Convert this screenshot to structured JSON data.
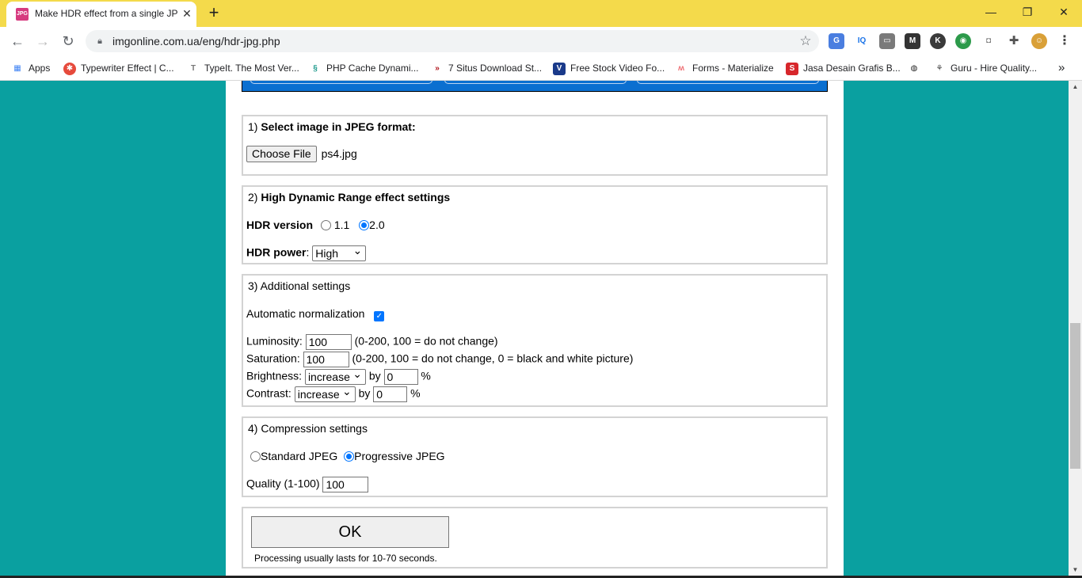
{
  "browser": {
    "tab_title": "Make HDR effect from a single JPG",
    "tab_favicon_text": "JPG",
    "url": "imgonline.com.ua/eng/hdr-jpg.php",
    "bookmarks": [
      {
        "label": "Apps",
        "icon": "apps-grid-icon"
      },
      {
        "label": "Typewriter Effect | C...",
        "icon": "typewriter-icon"
      },
      {
        "label": "TypeIt. The Most Ver...",
        "icon": "typeit-icon"
      },
      {
        "label": "PHP Cache Dynami...",
        "icon": "php-cache-icon"
      },
      {
        "label": "7 Situs Download St...",
        "icon": "chevrons-icon"
      },
      {
        "label": "Free Stock Video Fo...",
        "icon": "v-logo-icon"
      },
      {
        "label": "Forms - Materialize",
        "icon": "materialize-icon"
      },
      {
        "label": "Jasa Desain Grafis B...",
        "icon": "s-logo-icon"
      },
      {
        "label": "",
        "icon": "globe-icon"
      },
      {
        "label": "Guru - Hire Quality...",
        "icon": "guru-icon"
      }
    ],
    "colors": {
      "titlebar": "#f4da4b",
      "page_bg": "#0aa0a0",
      "banner": "#0b6fd0",
      "accent": "#0075ff"
    }
  },
  "form": {
    "section1": {
      "number": "1)",
      "title": "Select image in JPEG format:",
      "choose_file_label": "Choose File",
      "file_name": "ps4.jpg"
    },
    "section2": {
      "number": "2)",
      "title": "High Dynamic Range effect settings",
      "hdr_version_label": "HDR version",
      "version_options": [
        "1.1",
        "2.0"
      ],
      "version_selected": "2.0",
      "hdr_power_label": "HDR power",
      "hdr_power_value": "High"
    },
    "section3": {
      "title": "3) Additional settings",
      "auto_normalization_label": "Automatic normalization",
      "auto_normalization_checked": true,
      "luminosity_label": "Luminosity:",
      "luminosity_value": "100",
      "luminosity_hint": "(0-200, 100 = do not change)",
      "saturation_label": "Saturation:",
      "saturation_value": "100",
      "saturation_hint": "(0-200, 100 = do not change, 0 = black and white picture)",
      "brightness_label": "Brightness:",
      "brightness_mode": "increase",
      "brightness_by": "by",
      "brightness_value": "0",
      "brightness_unit": "%",
      "contrast_label": "Contrast:",
      "contrast_mode": "increase",
      "contrast_by": "by",
      "contrast_value": "0",
      "contrast_unit": "%"
    },
    "section4": {
      "title": "4) Compression settings",
      "standard_label": "Standard JPEG",
      "progressive_label": "Progressive JPEG",
      "selected": "Progressive JPEG",
      "quality_label": "Quality (1-100)",
      "quality_value": "100"
    },
    "submit": {
      "ok_label": "OK",
      "note": "Processing usually lasts for 10-70 seconds."
    }
  }
}
